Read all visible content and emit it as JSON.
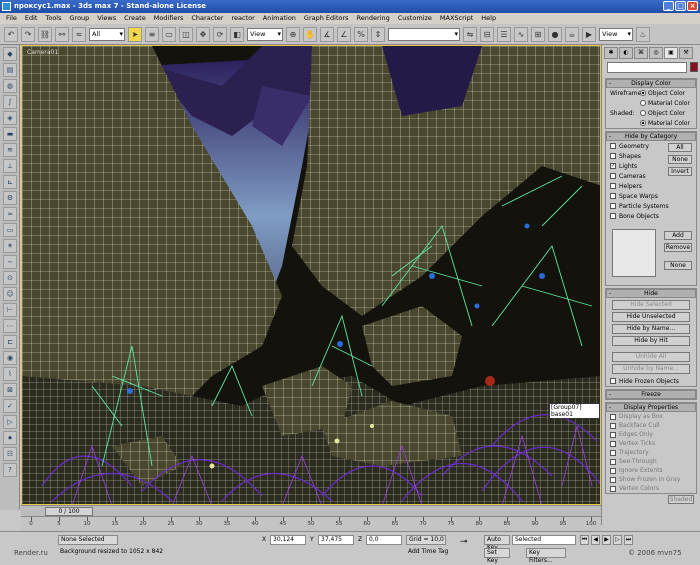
{
  "window": {
    "title": "проксус1.max - 3ds max 7 - Stand-alone License"
  },
  "menu": [
    "File",
    "Edit",
    "Tools",
    "Group",
    "Views",
    "Create",
    "Modifiers",
    "Character",
    "reactor",
    "Animation",
    "Graph Editors",
    "Rendering",
    "Customize",
    "MAXScript",
    "Help"
  ],
  "toolbar": {
    "selection_filter": "All",
    "ref_coord": "View",
    "named_sel": "",
    "view_dropdown": "View"
  },
  "viewport": {
    "label": "Camera01",
    "object_tag": "[Group07] base01"
  },
  "cmdpanel": {
    "display_color": {
      "title": "Display Color",
      "wireframe_label": "Wireframe:",
      "shaded_label": "Shaded:",
      "object_color": "Object Color",
      "material_color": "Material Color"
    },
    "hide_by_category": {
      "title": "Hide by Category",
      "items": [
        "Geometry",
        "Shapes",
        "Lights",
        "Cameras",
        "Helpers",
        "Space Warps",
        "Particle Systems",
        "Bone Objects"
      ],
      "checked": [
        false,
        false,
        true,
        false,
        false,
        false,
        false,
        false
      ],
      "all": "All",
      "none": "None",
      "invert": "Invert",
      "add": "Add",
      "remove": "Remove",
      "none2": "None"
    },
    "hide": {
      "title": "Hide",
      "buttons": [
        "Hide Selected",
        "Hide Unselected",
        "Hide by Name...",
        "Hide by Hit"
      ],
      "unhide_all": "Unhide All",
      "unhide_by_name": "Unhide by Name...",
      "hide_frozen": "Hide Frozen Objects"
    },
    "freeze": {
      "title": "Freeze"
    },
    "display_properties": {
      "title": "Display Properties",
      "items": [
        "Display as Box",
        "Backface Cull",
        "Edges Only",
        "Vertex Ticks",
        "Trajectory",
        "See-Through",
        "Ignore Extents",
        "Show Frozen in Gray",
        "Vertex Colors"
      ],
      "shaded_btn": "Shaded"
    }
  },
  "timeline": {
    "position": "0 / 100",
    "ticks": [
      "0",
      "5",
      "10",
      "15",
      "20",
      "25",
      "30",
      "35",
      "40",
      "45",
      "50",
      "55",
      "60",
      "65",
      "70",
      "75",
      "80",
      "85",
      "90",
      "95",
      "100"
    ]
  },
  "status": {
    "selection": "None Selected",
    "prompt": "Background resized to 1052 x 842",
    "x_label": "X",
    "x": "30,124",
    "y_label": "Y",
    "y": "37,475",
    "z_label": "Z",
    "z": "0,0",
    "grid": "Grid = 10,0",
    "add_time_tag": "Add Time Tag",
    "auto_key": "Auto Key",
    "set_key": "Set Key",
    "key_mode": "Selected",
    "key_filters": "Key Filters...",
    "site_left": "Render.ru",
    "site_right": "© 2006 mvn75"
  },
  "colors": {
    "title_bar": "#2a5ab8",
    "selection_highlight": "#f4d84a",
    "viewport_border": "#e8c84a",
    "object_color_swatch": "#8a1020"
  }
}
